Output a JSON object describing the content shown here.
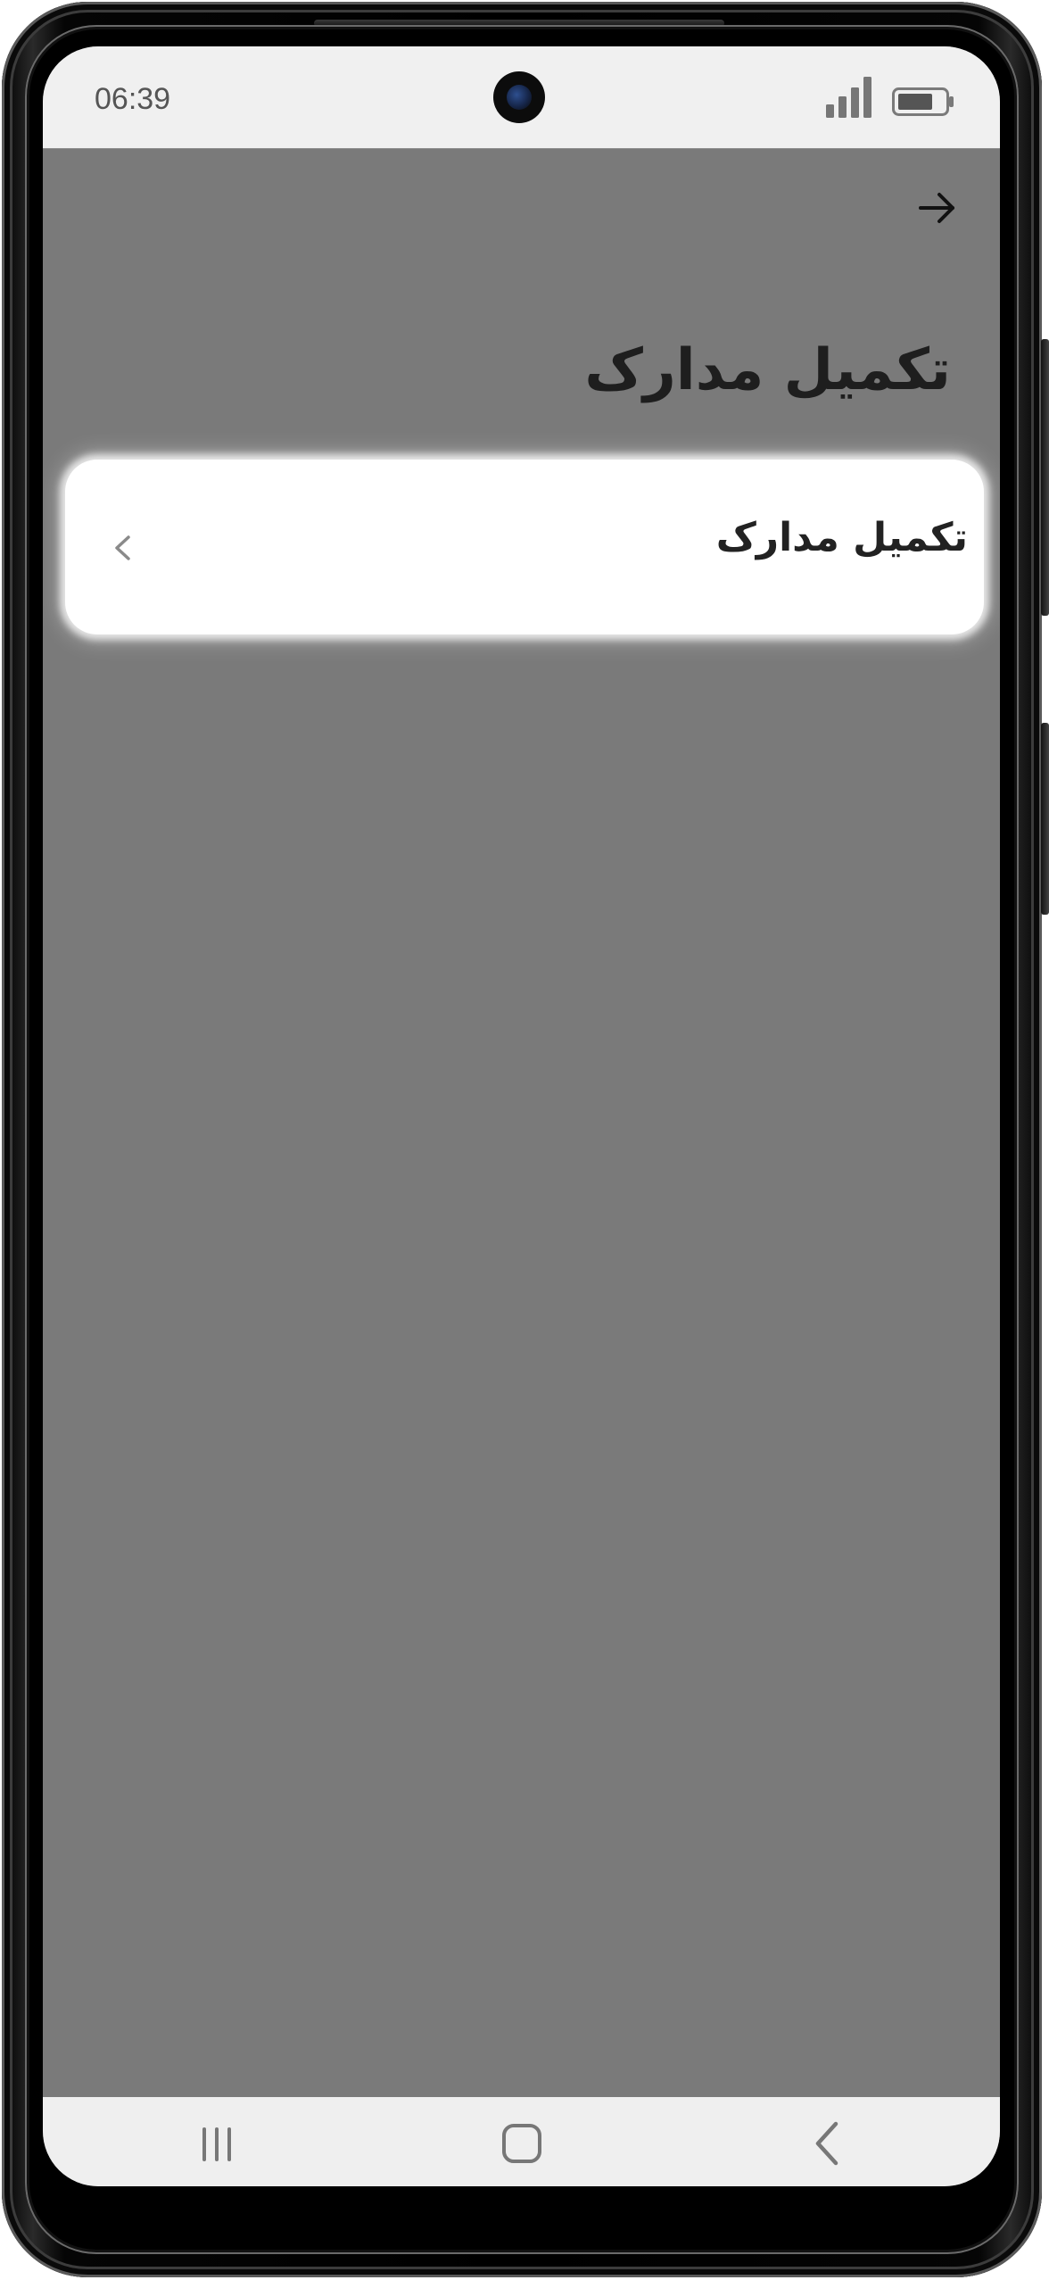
{
  "status_bar": {
    "time": "06:39",
    "camera_icon": "front-camera-icon",
    "signal_icon": "cellular-signal-icon",
    "battery_icon": "battery-icon"
  },
  "header": {
    "back_icon": "arrow-right-icon",
    "title": "تکمیل مدارک"
  },
  "list": {
    "items": [
      {
        "label": "تکمیل مدارک",
        "icon": "chevron-left-icon"
      }
    ]
  },
  "nav_bar": {
    "recents_icon": "recents-icon",
    "home_icon": "home-icon",
    "back_icon": "back-chevron-icon"
  },
  "colors": {
    "screen_background": "#7a7a7a",
    "status_bar_background": "#f0f0f0",
    "card_background": "#ffffff",
    "title_text": "#1e1e1e",
    "icon_gray": "#8a8a8a"
  }
}
